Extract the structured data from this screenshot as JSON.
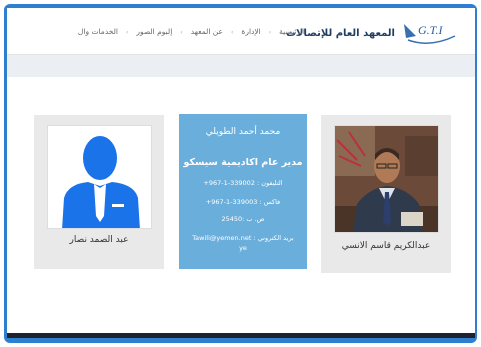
{
  "header": {
    "brand_title": "المعهد العام للإتصالات",
    "logo_text": "G.T.I",
    "nav": [
      {
        "label": "الرئيسية"
      },
      {
        "label": "الإدارة"
      },
      {
        "label": "عن المعهد"
      },
      {
        "label": "إلبوم الصور"
      },
      {
        "label": "الخدمات وال"
      }
    ]
  },
  "profiles": {
    "left": {
      "name": "عبد الصمد نصار"
    },
    "right": {
      "name": "عبدالكريم قاسم الانسي"
    }
  },
  "info_card": {
    "name": "محمد أحمد الطويلي",
    "role": "مدير عام اكاديمية سيسكو",
    "phone": "التليفون : 339002-1-967+",
    "fax": "فاكس : 339003-1-967+",
    "pobox": "ص. ب :25450",
    "email_line1": "بريد الكتروني : Tawili@yemen.net",
    "email_line2": "ye"
  },
  "colors": {
    "frame": "#2f7fd0",
    "info_card": "#6aaedc",
    "card_bg": "#e9e9e9",
    "silhouette": "#1a73e8"
  }
}
